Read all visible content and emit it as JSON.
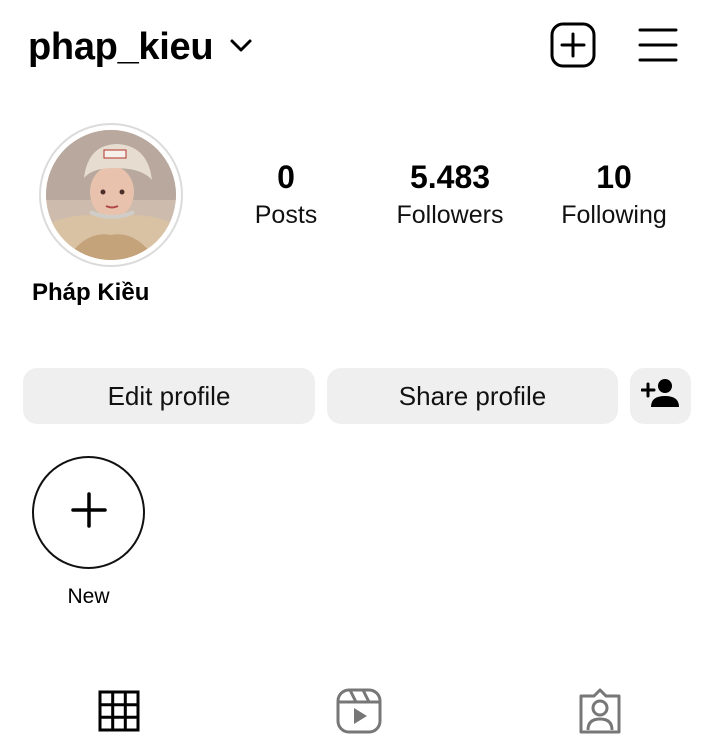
{
  "header": {
    "username": "phap_kieu",
    "icons": {
      "switch_account": "chevron-down-icon",
      "create": "plus-square-icon",
      "menu": "hamburger-menu-icon"
    }
  },
  "profile": {
    "full_name": "Pháp Kiều",
    "stats": {
      "posts": {
        "value": "0",
        "label": "Posts"
      },
      "followers": {
        "value": "5.483",
        "label": "Followers"
      },
      "following": {
        "value": "10",
        "label": "Following"
      }
    }
  },
  "actions": {
    "edit_label": "Edit profile",
    "share_label": "Share profile",
    "discover_icon": "add-person-icon"
  },
  "highlights": {
    "new_label": "New",
    "new_icon": "plus-icon"
  },
  "tabs": [
    {
      "name": "posts-grid",
      "icon": "grid-icon",
      "active": true
    },
    {
      "name": "reels",
      "icon": "reels-icon",
      "active": false
    },
    {
      "name": "tagged",
      "icon": "tagged-person-icon",
      "active": false
    }
  ],
  "colors": {
    "button_bg": "#efefef",
    "text": "#000000",
    "avatar_ring": "#dbdbdb"
  }
}
